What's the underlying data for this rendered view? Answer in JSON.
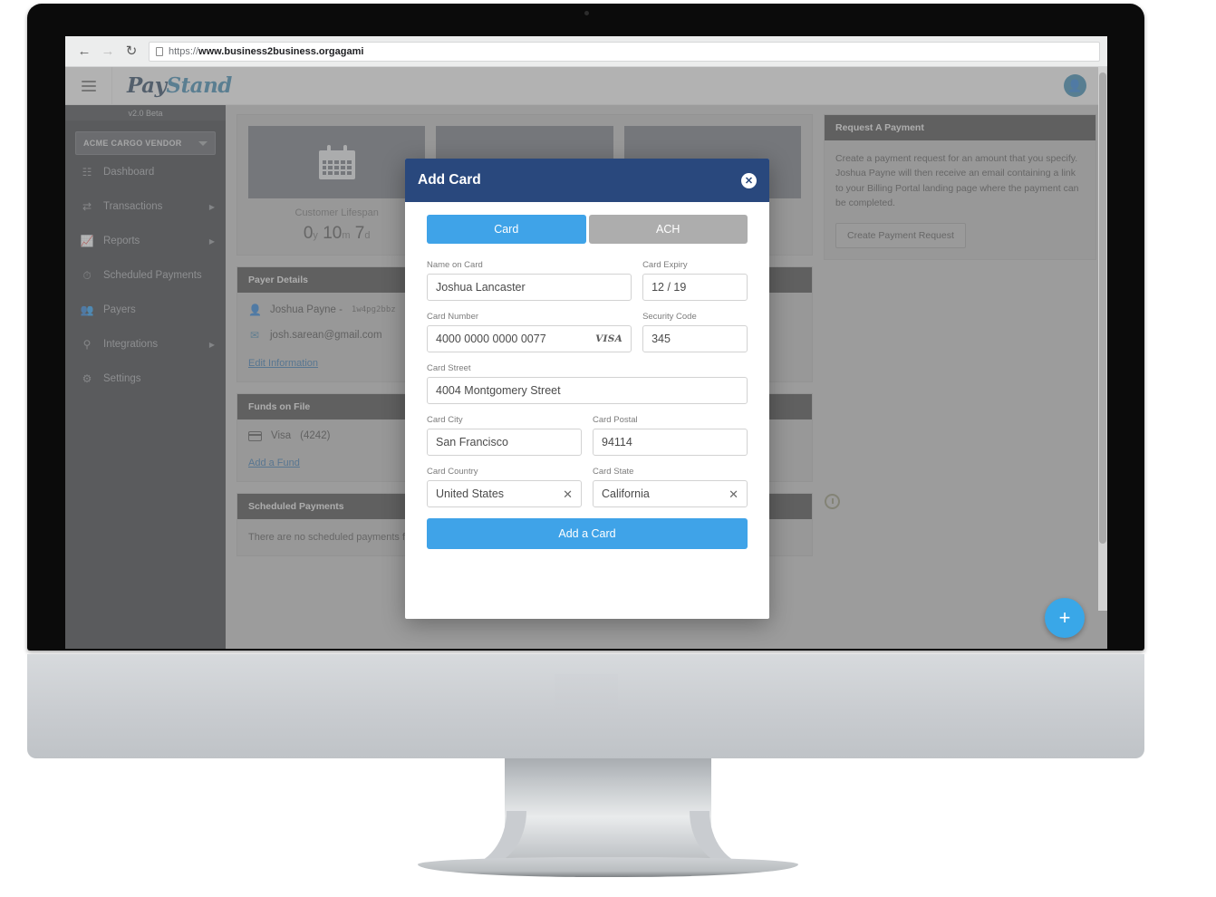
{
  "browser": {
    "url_scheme": "https://",
    "url_host": "www.business2business.orgagami",
    "back_icon": "back-arrow-icon",
    "forward_icon": "forward-arrow-icon",
    "reload_icon": "reload-icon",
    "page_icon": "page-document-icon"
  },
  "app_header": {
    "menu_icon": "hamburger-menu-icon",
    "brand_part1": "Pay",
    "brand_part2": "Stand",
    "avatar_icon": "user-avatar-icon"
  },
  "sidebar": {
    "version": "v2.0 Beta",
    "vendor": "ACME CARGO VENDOR",
    "items": [
      {
        "label": "Dashboard",
        "icon": "dashboard-icon",
        "has_arrow": false
      },
      {
        "label": "Transactions",
        "icon": "transactions-icon",
        "has_arrow": true
      },
      {
        "label": "Reports",
        "icon": "reports-chart-icon",
        "has_arrow": true
      },
      {
        "label": "Scheduled Payments",
        "icon": "clock-icon",
        "has_arrow": false
      },
      {
        "label": "Payers",
        "icon": "users-group-icon",
        "has_arrow": false
      },
      {
        "label": "Integrations",
        "icon": "plug-icon",
        "has_arrow": true
      },
      {
        "label": "Settings",
        "icon": "gear-icon",
        "has_arrow": false
      }
    ]
  },
  "stats": {
    "lifespan_icon": "calendar-icon",
    "lifespan_label": "Customer Lifespan",
    "lifespan_years": "0",
    "lifespan_years_unit": "y",
    "lifespan_months": "10",
    "lifespan_months_unit": "m",
    "lifespan_days": "7",
    "lifespan_days_unit": "d"
  },
  "payer_details": {
    "title": "Payer Details",
    "name": "Joshua Payne -",
    "id": "1w4pg2bbz",
    "email": "josh.sarean@gmail.com",
    "edit_link": "Edit Information",
    "person_icon": "person-icon",
    "mail_icon": "envelope-icon"
  },
  "funds_on_file": {
    "title": "Funds on File",
    "fund_brand": "Visa",
    "fund_last4": "(4242)",
    "card_icon": "credit-card-icon",
    "add_link": "Add a Fund"
  },
  "scheduled_payments": {
    "title": "Scheduled Payments",
    "empty_text": "There are no scheduled payments for this payer."
  },
  "request_payment": {
    "title": "Request A Payment",
    "description": "Create a payment request for an amount that you specify. Joshua Payne will then receive an email containing a link to your Billing Portal landing page where the payment can be completed.",
    "button": "Create Payment Request"
  },
  "fab": {
    "icon": "plus-icon",
    "label": "+"
  },
  "modal": {
    "title": "Add Card",
    "close_icon": "close-x-icon",
    "tabs": [
      {
        "label": "Card",
        "active": true
      },
      {
        "label": "ACH",
        "active": false
      }
    ],
    "fields": {
      "name_on_card_label": "Name on Card",
      "name_on_card_value": "Joshua Lancaster",
      "card_expiry_label": "Card Expiry",
      "card_expiry_value": "12 / 19",
      "card_number_label": "Card Number",
      "card_number_value": "4000 0000 0000 0077",
      "card_brand_mark": "VISA",
      "security_code_label": "Security Code",
      "security_code_value": "345",
      "card_street_label": "Card Street",
      "card_street_value": "4004 Montgomery Street",
      "card_city_label": "Card City",
      "card_city_value": "San Francisco",
      "card_postal_label": "Card Postal",
      "card_postal_value": "94114",
      "card_country_label": "Card Country",
      "card_country_value": "United States",
      "card_state_label": "Card State",
      "card_state_value": "California",
      "clear_icon": "clear-x-icon"
    },
    "submit_label": "Add a Card"
  },
  "colors": {
    "modal_header": "#29487d",
    "accent_blue": "#3fa3e8",
    "sidebar_bg": "#2f3136",
    "panel_head": "#3c3c3c"
  }
}
